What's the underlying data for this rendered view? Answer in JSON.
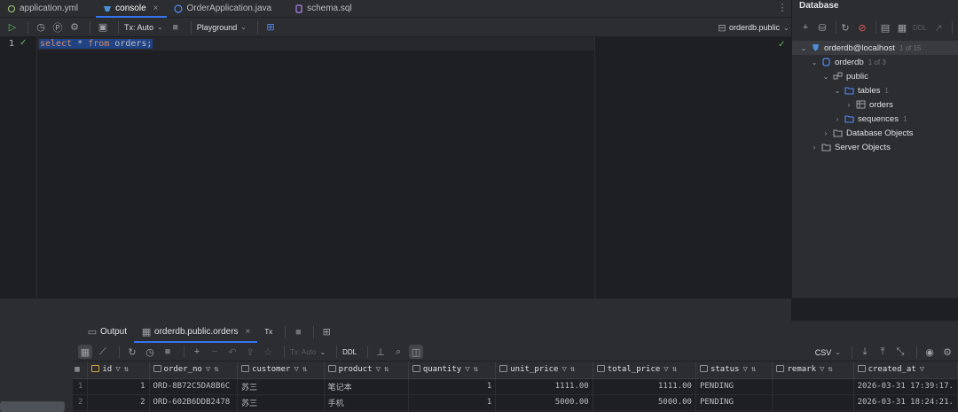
{
  "tabs": [
    {
      "label": "application.yml",
      "icon": "yaml-icon"
    },
    {
      "label": "console",
      "icon": "console-icon"
    },
    {
      "label": "OrderApplication.java",
      "icon": "java-class-icon"
    },
    {
      "label": "schema.sql",
      "icon": "sql-file-icon"
    }
  ],
  "editor_toolbar": {
    "tx_mode": "Tx: Auto",
    "session": "Playground",
    "schema": "orderdb.public"
  },
  "editor": {
    "line_number": "1",
    "code_kw1": "select",
    "code_mid": " * ",
    "code_kw2": "from",
    "code_end": " orders;"
  },
  "results": {
    "tabs": [
      {
        "label": "Output"
      },
      {
        "label": "orderdb.public.orders"
      },
      {
        "label": "Tx"
      }
    ],
    "tx_mode": "Tx: Auto",
    "ddl_label": "DDL",
    "export_format": "CSV",
    "columns": [
      "id",
      "order_no",
      "customer",
      "product",
      "quantity",
      "unit_price",
      "total_price",
      "status",
      "remark",
      "created_at"
    ],
    "rows": [
      [
        "1",
        "1",
        "ORD-8B72C5DA8B6C",
        "苏三",
        "笔记本",
        "1",
        "1111.00",
        "1111.00",
        "PENDING",
        "",
        "2026-03-31 17:39:17."
      ],
      [
        "2",
        "2",
        "ORD-602B6DDB2478",
        "苏三",
        "手机",
        "1",
        "5000.00",
        "5000.00",
        "PENDING",
        "",
        "2026-03-31 18:24:21."
      ]
    ]
  },
  "database": {
    "title": "Database",
    "ddl_label": "DDL",
    "tree": {
      "connection": "orderdb@localhost",
      "connection_count": "1 of 15",
      "database": "orderdb",
      "database_count": "1 of 3",
      "schema": "public",
      "tables": "tables",
      "tables_count": "1",
      "table": "orders",
      "sequences": "sequences",
      "sequences_count": "1",
      "db_objects": "Database Objects",
      "server_objects": "Server Objects"
    }
  },
  "colors": {
    "accent": "#3574f0",
    "success": "#5fb865",
    "keyword": "#cf8e6d",
    "selection": "#214283"
  }
}
